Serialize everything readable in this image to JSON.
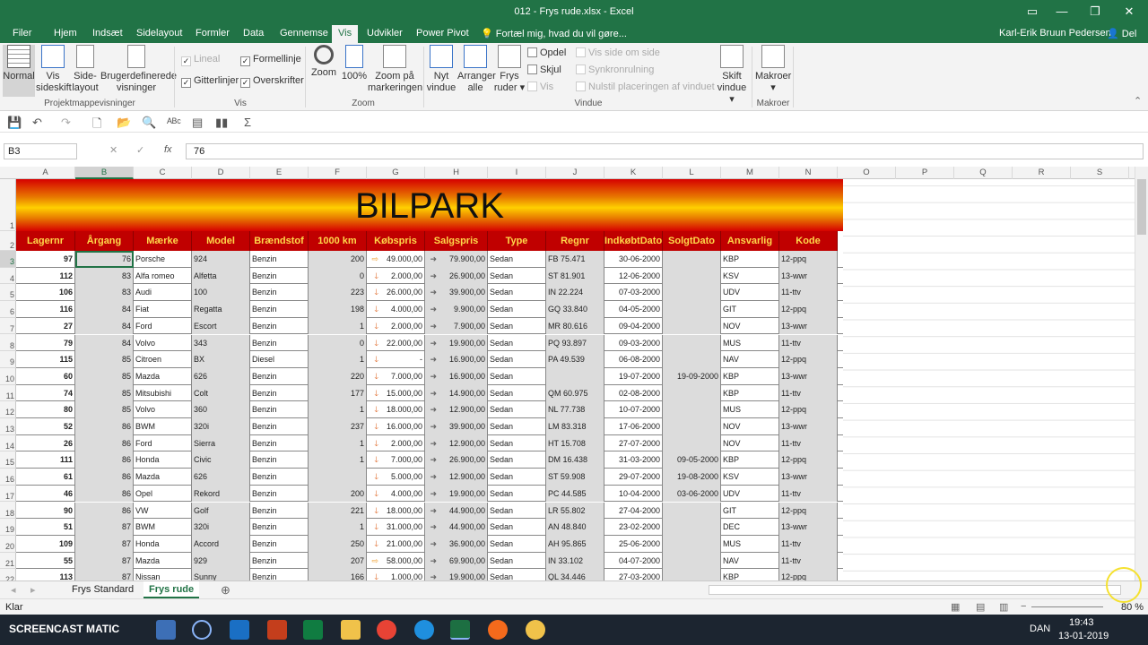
{
  "window": {
    "title": "012 - Frys rude.xlsx - Excel",
    "user": "Karl-Erik Bruun Pedersen",
    "share": "Del"
  },
  "ribbon_tabs": [
    "Filer",
    "Hjem",
    "Indsæt",
    "Sidelayout",
    "Formler",
    "Data",
    "Gennemse",
    "Vis",
    "Udvikler",
    "Power Pivot",
    "Fortæl mig, hvad du vil gøre..."
  ],
  "ribbon": {
    "views": [
      "Normal",
      "Vis sideskift",
      "Side-layout",
      "Brugerdefinerede visninger"
    ],
    "views_group": "Projektmappevisninger",
    "show": {
      "linjal": "Lineal",
      "formel": "Formellinje",
      "gitter": "Gitterlinjer",
      "overskrift": "Overskrifter"
    },
    "show_group": "Vis",
    "zoom": [
      "Zoom",
      "100%",
      "Zoom på markeringen"
    ],
    "zoom_group": "Zoom",
    "window": [
      "Nyt vindue",
      "Arranger alle",
      "Frys ruder",
      "Opdel",
      "Skjul",
      "Vis",
      "Vis side om side",
      "Synkronrulning",
      "Nulstil placeringen af vinduet",
      "Skift vindue"
    ],
    "window_group": "Vindue",
    "macro": [
      "Makroer"
    ],
    "macro_group": "Makroer"
  },
  "namebox": "B3",
  "formula": "76",
  "columns": [
    "A",
    "B",
    "C",
    "D",
    "E",
    "F",
    "G",
    "H",
    "I",
    "J",
    "K",
    "L",
    "M",
    "N",
    "O",
    "P",
    "Q",
    "R",
    "S"
  ],
  "banner": "BILPARK",
  "headers": [
    "Lagernr",
    "Årgang",
    "Mærke",
    "Model",
    "Brændstof",
    "1000 km",
    "Købspris",
    "Salgspris",
    "Type",
    "Regnr",
    "IndkøbtDato",
    "SolgtDato",
    "Ansvarlig",
    "Kode"
  ],
  "row_numbers": [
    "1",
    "2",
    "3",
    "4",
    "5",
    "6",
    "7",
    "8",
    "9",
    "10",
    "11",
    "12",
    "13",
    "14",
    "15",
    "16",
    "17",
    "18",
    "19",
    "20",
    "21",
    "22"
  ],
  "rows": [
    [
      "97",
      "76",
      "Porsche",
      "924",
      "Benzin",
      "200",
      "49.000,00",
      "79.900,00",
      "Sedan",
      "FB 75.471",
      "30-06-2000",
      "",
      "KBP",
      "12-ppq"
    ],
    [
      "112",
      "83",
      "Alfa romeo",
      "Alfetta",
      "Benzin",
      "0",
      "2.000,00",
      "26.900,00",
      "Sedan",
      "ST 81.901",
      "12-06-2000",
      "",
      "KSV",
      "13-wwr"
    ],
    [
      "106",
      "83",
      "Audi",
      "100",
      "Benzin",
      "223",
      "26.000,00",
      "39.900,00",
      "Sedan",
      "IN 22.224",
      "07-03-2000",
      "",
      "UDV",
      "11-ttv"
    ],
    [
      "116",
      "84",
      "Fiat",
      "Regatta",
      "Benzin",
      "198",
      "4.000,00",
      "9.900,00",
      "Sedan",
      "GQ 33.840",
      "04-05-2000",
      "",
      "GIT",
      "12-ppq"
    ],
    [
      "27",
      "84",
      "Ford",
      "Escort",
      "Benzin",
      "1",
      "2.000,00",
      "7.900,00",
      "Sedan",
      "MR 80.616",
      "09-04-2000",
      "",
      "NOV",
      "13-wwr"
    ],
    [
      "79",
      "84",
      "Volvo",
      "343",
      "Benzin",
      "0",
      "22.000,00",
      "19.900,00",
      "Sedan",
      "PQ 93.897",
      "09-03-2000",
      "",
      "MUS",
      "11-ttv"
    ],
    [
      "115",
      "85",
      "Citroen",
      "BX",
      "Diesel",
      "1",
      "-",
      "16.900,00",
      "Sedan",
      "PA 49.539",
      "06-08-2000",
      "",
      "NAV",
      "12-ppq"
    ],
    [
      "60",
      "85",
      "Mazda",
      "626",
      "Benzin",
      "220",
      "7.000,00",
      "16.900,00",
      "Sedan",
      "",
      "19-07-2000",
      "19-09-2000",
      "KBP",
      "13-wwr"
    ],
    [
      "74",
      "85",
      "Mitsubishi",
      "Colt",
      "Benzin",
      "177",
      "15.000,00",
      "14.900,00",
      "Sedan",
      "QM 60.975",
      "02-08-2000",
      "",
      "KBP",
      "11-ttv"
    ],
    [
      "80",
      "85",
      "Volvo",
      "360",
      "Benzin",
      "1",
      "18.000,00",
      "12.900,00",
      "Sedan",
      "NL 77.738",
      "10-07-2000",
      "",
      "MUS",
      "12-ppq"
    ],
    [
      "52",
      "86",
      "BWM",
      "320i",
      "Benzin",
      "237",
      "16.000,00",
      "39.900,00",
      "Sedan",
      "LM 83.318",
      "17-06-2000",
      "",
      "NOV",
      "13-wwr"
    ],
    [
      "26",
      "86",
      "Ford",
      "Sierra",
      "Benzin",
      "1",
      "2.000,00",
      "12.900,00",
      "Sedan",
      "HT 15.708",
      "27-07-2000",
      "",
      "NOV",
      "11-ttv"
    ],
    [
      "111",
      "86",
      "Honda",
      "Civic",
      "Benzin",
      "1",
      "7.000,00",
      "26.900,00",
      "Sedan",
      "DM 16.438",
      "31-03-2000",
      "09-05-2000",
      "KBP",
      "12-ppq"
    ],
    [
      "61",
      "86",
      "Mazda",
      "626",
      "Benzin",
      "",
      "5.000,00",
      "12.900,00",
      "Sedan",
      "ST 59.908",
      "29-07-2000",
      "19-08-2000",
      "KSV",
      "13-wwr"
    ],
    [
      "46",
      "86",
      "Opel",
      "Rekord",
      "Benzin",
      "200",
      "4.000,00",
      "19.900,00",
      "Sedan",
      "PC 44.585",
      "10-04-2000",
      "03-06-2000",
      "UDV",
      "11-ttv"
    ],
    [
      "90",
      "86",
      "VW",
      "Golf",
      "Benzin",
      "221",
      "18.000,00",
      "44.900,00",
      "Sedan",
      "LR 55.802",
      "27-04-2000",
      "",
      "GIT",
      "12-ppq"
    ],
    [
      "51",
      "87",
      "BWM",
      "320i",
      "Benzin",
      "1",
      "31.000,00",
      "44.900,00",
      "Sedan",
      "AN 48.840",
      "23-02-2000",
      "",
      "DEC",
      "13-wwr"
    ],
    [
      "109",
      "87",
      "Honda",
      "Accord",
      "Benzin",
      "250",
      "21.000,00",
      "36.900,00",
      "Sedan",
      "AH 95.865",
      "25-06-2000",
      "",
      "MUS",
      "11-ttv"
    ],
    [
      "55",
      "87",
      "Mazda",
      "929",
      "Benzin",
      "207",
      "58.000,00",
      "69.900,00",
      "Sedan",
      "IN 33.102",
      "04-07-2000",
      "",
      "NAV",
      "11-ttv"
    ],
    [
      "113",
      "87",
      "Nissan",
      "Sunny",
      "Benzin",
      "166",
      "1.000,00",
      "19.900,00",
      "Sedan",
      "QL 34.446",
      "27-03-2000",
      "",
      "KBP",
      "12-ppq"
    ]
  ],
  "sheet_tabs": [
    "Frys Standard",
    "Frys rude"
  ],
  "status": {
    "ready": "Klar",
    "zoom": "80 %"
  },
  "taskbar": {
    "lang": "DAN",
    "time": "19:43",
    "date": "13-01-2019",
    "recorder": "SCREENCAST MATIC"
  }
}
